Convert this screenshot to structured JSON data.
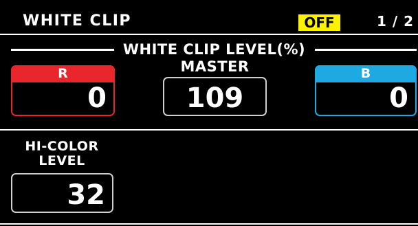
{
  "header": {
    "title": "WHITE CLIP",
    "status": "OFF",
    "page": "1 / 2"
  },
  "section": {
    "title": "WHITE CLIP LEVEL(%)"
  },
  "channels": {
    "r": {
      "label": "R",
      "value": "0",
      "color": "#e8262b"
    },
    "master": {
      "label": "MASTER",
      "value": "109"
    },
    "b": {
      "label": "B",
      "value": "0",
      "color": "#1fa9e3"
    }
  },
  "hi_color": {
    "label_line1": "HI-COLOR",
    "label_line2": "LEVEL",
    "value": "32"
  },
  "colors": {
    "background": "#000000",
    "status_badge": "#fff200"
  }
}
